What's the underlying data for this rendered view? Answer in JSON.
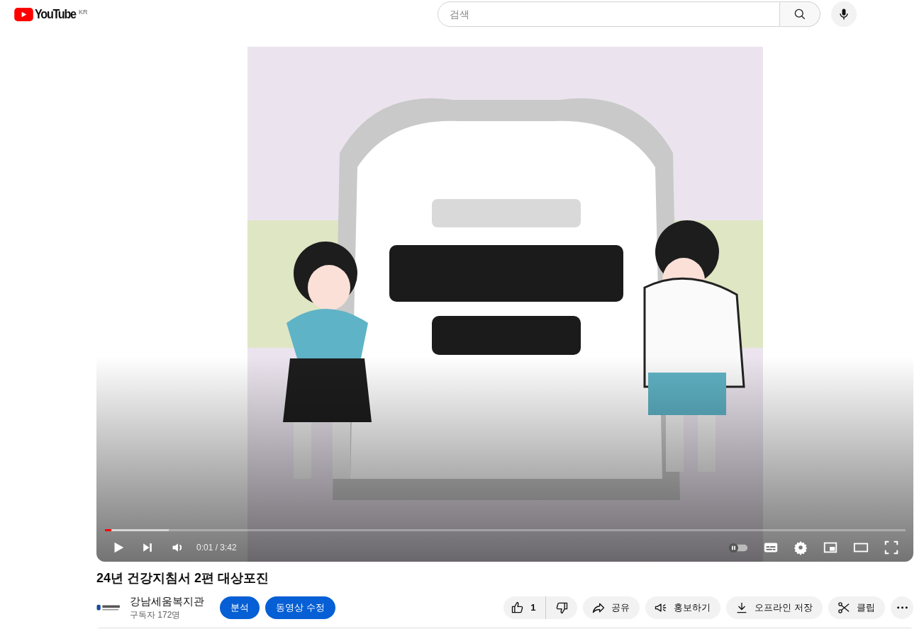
{
  "header": {
    "logo_text": "YouTube",
    "region": "KR",
    "search": {
      "placeholder": "검색"
    }
  },
  "player": {
    "progress": {
      "level": 0.008
    },
    "time": "0:01 / 3:42"
  },
  "video": {
    "title": "24년 건강지침서 2편 대상포진"
  },
  "channel": {
    "name": "강남세움복지관",
    "subscribers": "구독자 172명"
  },
  "owner_buttons": [
    "분석",
    "동영상 수정"
  ],
  "actions": {
    "likes": "1",
    "items": [
      {
        "kind": "share",
        "label": "공유"
      },
      {
        "kind": "promote",
        "label": "홍보하기"
      },
      {
        "kind": "download",
        "label": "오프라인 저장"
      },
      {
        "kind": "clip",
        "label": "클립"
      }
    ]
  }
}
